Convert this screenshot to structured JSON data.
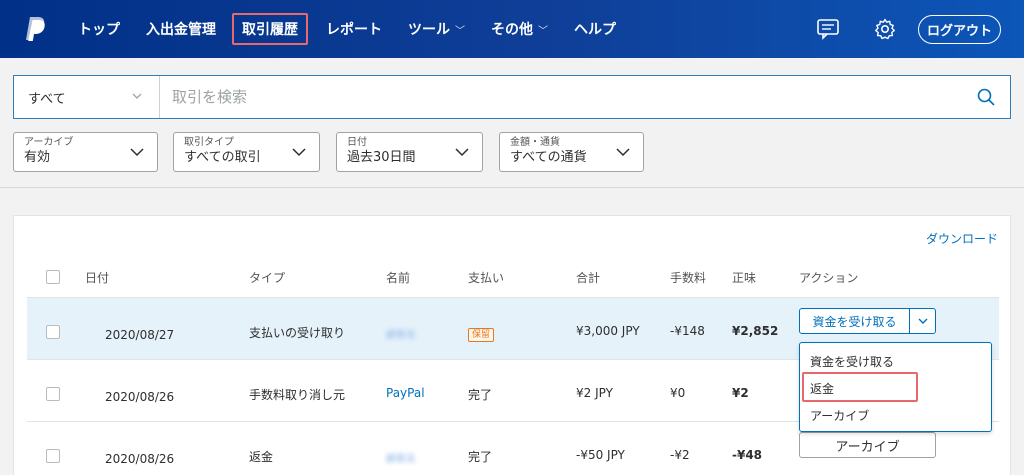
{
  "header": {
    "nav": [
      {
        "label": "トップ",
        "dropdown": false,
        "active": false
      },
      {
        "label": "入出金管理",
        "dropdown": false,
        "active": false
      },
      {
        "label": "取引履歴",
        "dropdown": false,
        "active": true
      },
      {
        "label": "レポート",
        "dropdown": false,
        "active": false
      },
      {
        "label": "ツール",
        "dropdown": true,
        "active": false
      },
      {
        "label": "その他",
        "dropdown": true,
        "active": false
      },
      {
        "label": "ヘルプ",
        "dropdown": false,
        "active": false
      }
    ],
    "icons": {
      "messages": "message-icon",
      "settings": "gear-icon"
    },
    "logout_label": "ログアウト",
    "colors": {
      "bar_start": "#003087",
      "bar_end": "#0c56b8",
      "highlight": "#e8696b"
    }
  },
  "search": {
    "filter_value": "すべて",
    "placeholder": "取引を検索"
  },
  "filters": [
    {
      "label": "アーカイブ",
      "value": "有効"
    },
    {
      "label": "取引タイプ",
      "value": "すべての取引"
    },
    {
      "label": "日付",
      "value": "過去30日間"
    },
    {
      "label": "金額・通貨",
      "value": "すべての通貨"
    }
  ],
  "table": {
    "download_label": "ダウンロード",
    "columns": [
      "日付",
      "タイプ",
      "名前",
      "支払い",
      "合計",
      "手数料",
      "正味",
      "アクション"
    ],
    "rows": [
      {
        "date": "2020/08/27",
        "type": "支払いの受け取り",
        "name": "顧客名",
        "name_blurred": true,
        "payment": "保留",
        "payment_badge": true,
        "total": "¥3,000 JPY",
        "fee": "-¥148",
        "net": "¥2,852",
        "action": "資金を受け取る",
        "action_type": "split"
      },
      {
        "date": "2020/08/26",
        "type": "手数料取り消し元",
        "name": "PayPal",
        "name_blurred": false,
        "payment": "完了",
        "payment_badge": false,
        "total": "¥2 JPY",
        "fee": "¥0",
        "net": "¥2",
        "action": "",
        "action_type": "none"
      },
      {
        "date": "2020/08/26",
        "type": "返金",
        "name": "顧客名",
        "name_blurred": true,
        "payment": "完了",
        "payment_badge": false,
        "total": "-¥50 JPY",
        "fee": "-¥2",
        "net": "-¥48",
        "action": "アーカイブ",
        "action_type": "button"
      }
    ]
  },
  "action_menu": {
    "items": [
      "資金を受け取る",
      "返金",
      "アーカイブ"
    ],
    "highlighted_index": 1
  }
}
